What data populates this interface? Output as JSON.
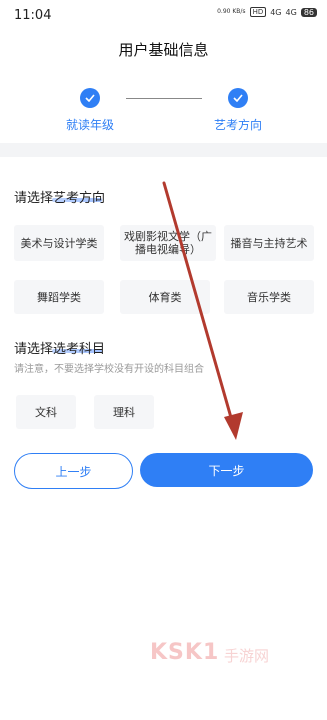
{
  "status": {
    "time": "11:04",
    "net_speed": "0.90 KB/s",
    "hd": "HD",
    "signal1": "4G",
    "signal2": "4G",
    "battery": "86"
  },
  "header": {
    "title": "用户基础信息"
  },
  "steps": [
    {
      "label": "就读年级"
    },
    {
      "label": "艺考方向"
    }
  ],
  "art_section": {
    "title": "请选择艺考方向",
    "options": [
      "美术与设计学类",
      "戏剧影视文学（广播电视编导）",
      "播音与主持艺术",
      "舞蹈学类",
      "体育类",
      "音乐学类"
    ]
  },
  "subject_section": {
    "title": "请选择选考科目",
    "note": "请注意，不要选择学校没有开设的科目组合",
    "options": [
      "文科",
      "理科"
    ]
  },
  "buttons": {
    "prev": "上一步",
    "next": "下一步"
  },
  "watermark": {
    "brand": "KSK1",
    "sub": "手游网"
  },
  "colors": {
    "accent": "#2f7ff5",
    "arrow": "#b23a2e"
  }
}
